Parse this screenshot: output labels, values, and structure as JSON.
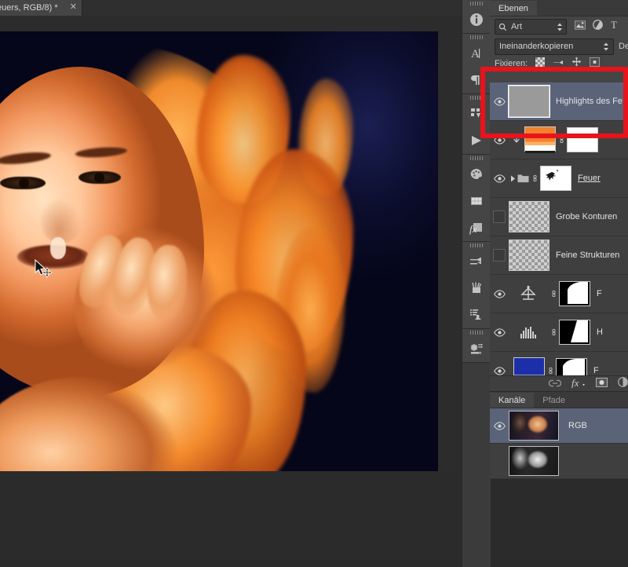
{
  "document_tab": {
    "title": "euers, RGB/8) *",
    "close_icon": "close-icon"
  },
  "canvas": {
    "description": "Photoshop canvas: portrait of a woman with fire-styled orange hair on a dark navy background",
    "cursor": "move-tool-cursor"
  },
  "icon_rail": {
    "groups": [
      {
        "items": [
          {
            "icon": "info-icon",
            "name": "info-panel-icon"
          }
        ]
      },
      {
        "items": [
          {
            "icon": "character-icon",
            "name": "character-panel-icon"
          },
          {
            "icon": "paragraph-icon",
            "name": "paragraph-panel-icon"
          }
        ]
      },
      {
        "items": [
          {
            "icon": "layer-comps-icon",
            "name": "layer-comps-panel-icon"
          },
          {
            "icon": "timeline-icon",
            "name": "timeline-panel-icon"
          }
        ]
      },
      {
        "items": [
          {
            "icon": "color-palette-icon",
            "name": "color-panel-icon"
          },
          {
            "icon": "swatches-icon",
            "name": "swatches-panel-icon"
          },
          {
            "icon": "fx-styles-icon",
            "name": "styles-panel-icon"
          }
        ]
      },
      {
        "items": [
          {
            "icon": "brush-icon",
            "name": "brush-panel-icon"
          },
          {
            "icon": "brush-presets-icon",
            "name": "brush-presets-panel-icon"
          },
          {
            "icon": "tool-presets-icon",
            "name": "tool-presets-panel-icon"
          }
        ]
      },
      {
        "items": [
          {
            "icon": "3d-icon",
            "name": "3d-panel-icon"
          }
        ]
      }
    ]
  },
  "layers_panel": {
    "tab_label": "Ebenen",
    "filter": {
      "search_icon": "search-icon",
      "kind_label": "Art",
      "stepper_icon": "stepper-icon",
      "icons": [
        {
          "name": "filter-pixel-icon",
          "label": "pixel-layers-filter"
        },
        {
          "name": "filter-adjustment-icon",
          "label": "adjustment-layers-filter"
        },
        {
          "name": "filter-type-icon",
          "label": "type-layers-filter"
        }
      ]
    },
    "blend_mode": "Ineinanderkopieren",
    "opacity_label": "Dec",
    "lock_row": {
      "label": "Fixieren:",
      "icons": [
        {
          "name": "lock-transparency-icon"
        },
        {
          "name": "lock-image-icon"
        },
        {
          "name": "lock-position-icon"
        },
        {
          "name": "lock-all-icon"
        }
      ]
    },
    "layers": [
      {
        "name": "Highlights des Fe",
        "visible": true,
        "selected": true,
        "type": "gray-fill",
        "truncated": true,
        "has_mask": false
      },
      {
        "name": "",
        "visible": true,
        "selected": false,
        "type": "gradient-orange",
        "clipped": true,
        "has_mask": true
      },
      {
        "name": "Feuer",
        "visible": true,
        "selected": false,
        "type": "group",
        "underlined": true,
        "has_mask": false
      },
      {
        "name": "Grobe Konturen",
        "visible": false,
        "selected": false,
        "type": "transparent-strokes",
        "has_mask": false
      },
      {
        "name": "Feine Strukturen",
        "visible": false,
        "selected": false,
        "type": "transparent-strokes",
        "has_mask": false
      },
      {
        "name": "F",
        "visible": true,
        "selected": false,
        "type": "adjustment-balance",
        "has_mask": true
      },
      {
        "name": "H",
        "visible": true,
        "selected": false,
        "type": "adjustment-levels",
        "has_mask": true
      },
      {
        "name": "F",
        "visible": true,
        "selected": false,
        "type": "solid-blue",
        "has_mask": true
      },
      {
        "name": "",
        "visible": true,
        "selected": false,
        "type": "photo",
        "has_mask": true
      }
    ],
    "footer_icons": [
      {
        "name": "link-layers-icon"
      },
      {
        "name": "layer-style-fx-icon"
      },
      {
        "name": "add-mask-icon"
      },
      {
        "name": "new-adjustment-icon"
      }
    ]
  },
  "channels_panel": {
    "tabs": [
      {
        "label": "Kanäle",
        "active": true
      },
      {
        "label": "Pfade",
        "active": false
      }
    ],
    "channels": [
      {
        "name": "RGB",
        "visible": true,
        "selected": true
      },
      {
        "name": "",
        "visible": false,
        "selected": false
      }
    ]
  },
  "annotation": {
    "color": "#e8131b",
    "shape": "rectangle-highlight",
    "target": "selected layer row and lock row"
  }
}
